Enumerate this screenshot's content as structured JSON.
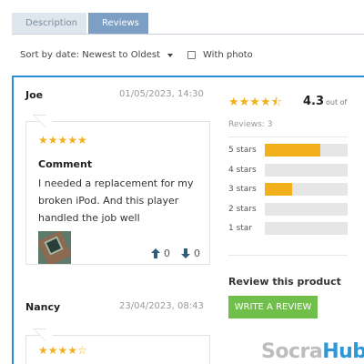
{
  "tabs": [
    {
      "label": "Description"
    },
    {
      "label": "Reviews"
    }
  ],
  "toolbar": {
    "sort_label": "Sort by date: Newest to Oldest",
    "photo_filter_label": "With photo"
  },
  "reviews": [
    {
      "name": "Joe",
      "date": "01/05/2023, 14:30",
      "stars": "★★★★★",
      "rating": 5,
      "comment_title": "Comment",
      "comment_text": "I needed a replacement for my broken iPod. And this player handled the job well",
      "upvotes": "0",
      "downvotes": "0"
    },
    {
      "name": "Nancy",
      "date": "23/04/2023, 08:43",
      "stars": "★★★★☆",
      "rating": 4
    }
  ],
  "summary": {
    "stars": "★★★★⯪",
    "rating": "4.3",
    "out_of": "out of",
    "count_text": "Reviews: 3",
    "bars": [
      {
        "label": "5 stars",
        "fraction": 0.667
      },
      {
        "label": "4 stars",
        "fraction": 0
      },
      {
        "label": "3 stars",
        "fraction": 0.333
      },
      {
        "label": "2 stars",
        "fraction": 0
      },
      {
        "label": "1 star",
        "fraction": 0
      }
    ]
  },
  "cta": {
    "heading": "Review this product",
    "button": "WRITE A REVIEW"
  },
  "watermark": {
    "part1": "Socra",
    "part2": "Hub"
  },
  "colors": {
    "accent": "#2c8fd6",
    "star": "#f2b11c",
    "button": "#6fbf4a",
    "tab_active": "#7d9fc4"
  }
}
